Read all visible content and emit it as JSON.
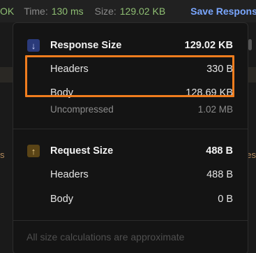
{
  "statusbar": {
    "ok_text": "OK",
    "time_label": "Time:",
    "time_value": "130 ms",
    "size_label": "Size:",
    "size_value": "129.02 KB",
    "save_label": "Save Respons"
  },
  "background": {
    "left_text": "s",
    "right_text": "es"
  },
  "response": {
    "title": "Response Size",
    "total": "129.02 KB",
    "icon": "arrow-down-icon",
    "headers_label": "Headers",
    "headers_value": "330 B",
    "body_label": "Body",
    "body_value": "128.69 KB",
    "uncompressed_label": "Uncompressed",
    "uncompressed_value": "1.02 MB"
  },
  "request": {
    "title": "Request Size",
    "total": "488 B",
    "icon": "arrow-up-icon",
    "headers_label": "Headers",
    "headers_value": "488 B",
    "body_label": "Body",
    "body_value": "0 B"
  },
  "footer_note": "All size calculations are approximate",
  "colors": {
    "highlight": "#f07d1e",
    "link": "#7aa7ff",
    "ok": "#8fbf73"
  }
}
